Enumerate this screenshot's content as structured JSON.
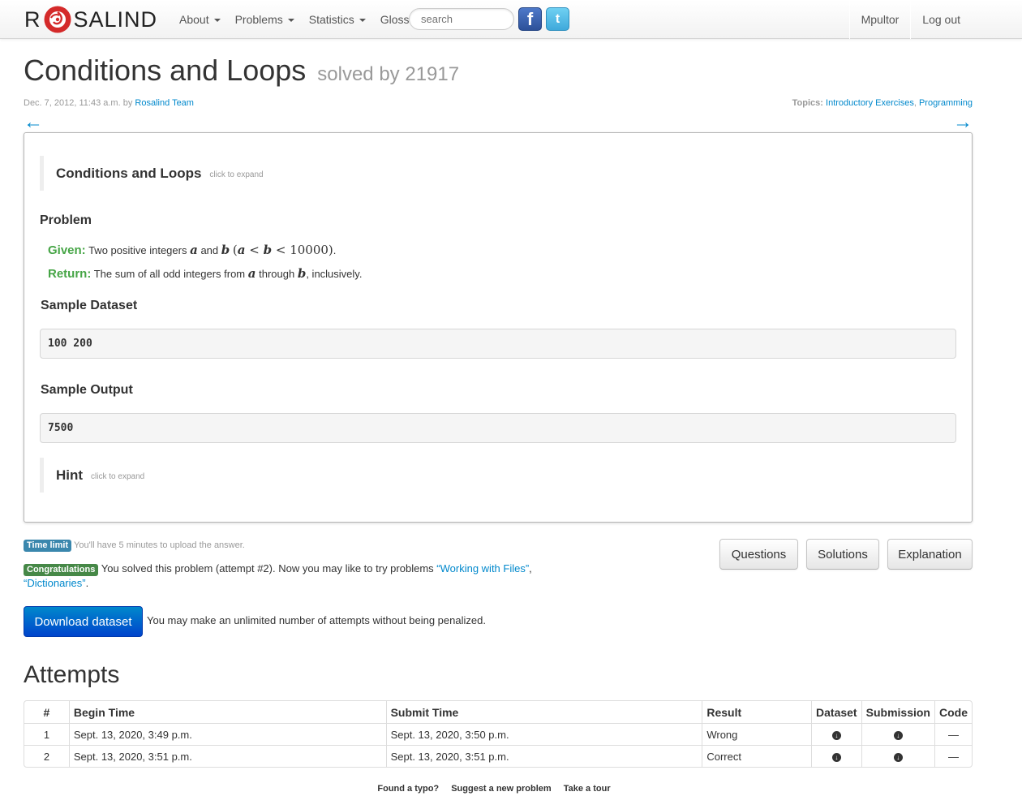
{
  "brand": {
    "left": "R",
    "right": "SALIND"
  },
  "nav": {
    "items": [
      {
        "label": "About",
        "dropdown": true
      },
      {
        "label": "Problems",
        "dropdown": true
      },
      {
        "label": "Statistics",
        "dropdown": true
      },
      {
        "label": "Glossary",
        "dropdown": false
      }
    ],
    "search_placeholder": "search",
    "facebook": "f",
    "twitter": "t",
    "user": "Mpultor",
    "logout": "Log out"
  },
  "problem": {
    "title": "Conditions and Loops",
    "solved_by": "solved by 21917",
    "date": "Dec. 7, 2012, 11:43 a.m.",
    "by": "by",
    "author": "Rosalind Team",
    "topics_label": "Topics:",
    "topics": [
      "Introductory Exercises",
      "Programming"
    ],
    "prev_arrow": "←",
    "next_arrow": "→",
    "expand_title": "Conditions and Loops",
    "click_to_expand": "click to expand",
    "problem_heading": "Problem",
    "given_label": "Given:",
    "given_text": "Two positive integers",
    "return_label": "Return:",
    "return_text": "The sum of all odd integers from",
    "sample_dataset_heading": "Sample Dataset",
    "sample_dataset": "100 200",
    "sample_output_heading": "Sample Output",
    "sample_output": "7500",
    "hint_title": "Hint"
  },
  "status": {
    "time_limit_badge": "Time limit",
    "time_limit_text": "You'll have 5 minutes to upload the answer.",
    "congrats_badge": "Congratulations",
    "congrats_text": "You solved this problem (attempt #2). Now you may like to try problems",
    "next_problems": [
      "“Working with Files”",
      "“Dictionaries”"
    ],
    "download_button": "Download dataset",
    "download_note": "You may make an unlimited number of attempts without being penalized."
  },
  "buttons": {
    "questions": "Questions",
    "solutions": "Solutions",
    "explanation": "Explanation"
  },
  "attempts": {
    "heading": "Attempts",
    "columns": [
      "#",
      "Begin Time",
      "Submit Time",
      "Result",
      "Dataset",
      "Submission",
      "Code"
    ],
    "rows": [
      {
        "num": "1",
        "begin": "Sept. 13, 2020, 3:49 p.m.",
        "submit": "Sept. 13, 2020, 3:50 p.m.",
        "result": "Wrong",
        "code": "—"
      },
      {
        "num": "2",
        "begin": "Sept. 13, 2020, 3:51 p.m.",
        "submit": "Sept. 13, 2020, 3:51 p.m.",
        "result": "Correct",
        "code": "—"
      }
    ]
  },
  "footer": [
    "Found a typo?",
    "Suggest a new problem",
    "Take a tour"
  ],
  "colors": {
    "link": "#0088cc",
    "given_green": "#46a546",
    "badge_info": "#3a87ad",
    "badge_success": "#468847",
    "primary": "#0044cc"
  }
}
